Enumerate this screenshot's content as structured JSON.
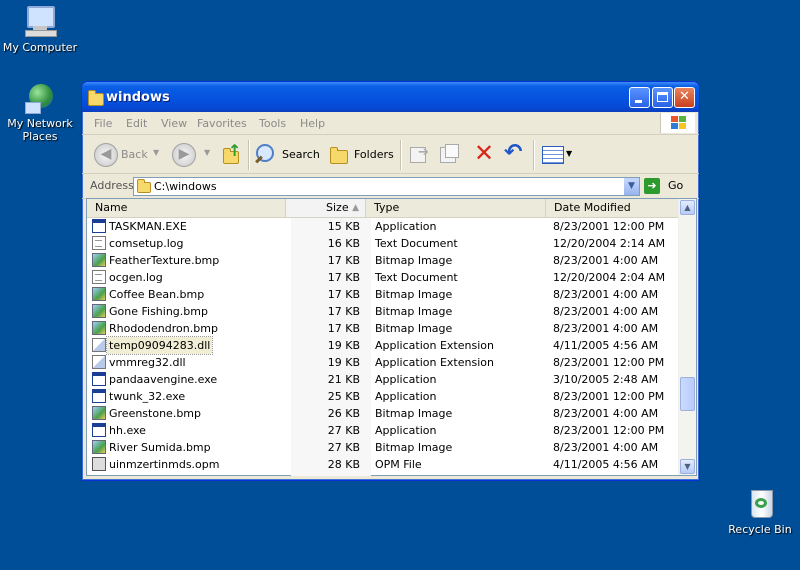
{
  "desktop": {
    "my_computer": "My Computer",
    "my_network": "My Network Places",
    "recycle_bin": "Recycle Bin"
  },
  "window": {
    "title": "windows",
    "menu": [
      "File",
      "Edit",
      "View",
      "Favorites",
      "Tools",
      "Help"
    ],
    "toolbar": {
      "back": "Back",
      "search": "Search",
      "folders": "Folders"
    },
    "address": {
      "label": "Address",
      "value": "C:\\windows",
      "go": "Go"
    },
    "columns": {
      "name": "Name",
      "size": "Size",
      "type": "Type",
      "date": "Date Modified"
    },
    "files": [
      {
        "name": "TASKMAN.EXE",
        "size": "15 KB",
        "type": "Application",
        "date": "8/23/2001 12:00 PM",
        "icon": "app"
      },
      {
        "name": "comsetup.log",
        "size": "16 KB",
        "type": "Text Document",
        "date": "12/20/2004 2:14 AM",
        "icon": "txt"
      },
      {
        "name": "FeatherTexture.bmp",
        "size": "17 KB",
        "type": "Bitmap Image",
        "date": "8/23/2001 4:00 AM",
        "icon": "bmp"
      },
      {
        "name": "ocgen.log",
        "size": "17 KB",
        "type": "Text Document",
        "date": "12/20/2004 2:04 AM",
        "icon": "txt"
      },
      {
        "name": "Coffee Bean.bmp",
        "size": "17 KB",
        "type": "Bitmap Image",
        "date": "8/23/2001 4:00 AM",
        "icon": "bmp"
      },
      {
        "name": "Gone Fishing.bmp",
        "size": "17 KB",
        "type": "Bitmap Image",
        "date": "8/23/2001 4:00 AM",
        "icon": "bmp"
      },
      {
        "name": "Rhododendron.bmp",
        "size": "17 KB",
        "type": "Bitmap Image",
        "date": "8/23/2001 4:00 AM",
        "icon": "bmp"
      },
      {
        "name": "temp09094283.dll",
        "size": "19 KB",
        "type": "Application Extension",
        "date": "4/11/2005 4:56 AM",
        "icon": "dll"
      },
      {
        "name": "vmmreg32.dll",
        "size": "19 KB",
        "type": "Application Extension",
        "date": "8/23/2001 12:00 PM",
        "icon": "dll"
      },
      {
        "name": "pandaavengine.exe",
        "size": "21 KB",
        "type": "Application",
        "date": "3/10/2005 2:48 AM",
        "icon": "app"
      },
      {
        "name": "twunk_32.exe",
        "size": "25 KB",
        "type": "Application",
        "date": "8/23/2001 12:00 PM",
        "icon": "app"
      },
      {
        "name": "Greenstone.bmp",
        "size": "26 KB",
        "type": "Bitmap Image",
        "date": "8/23/2001 4:00 AM",
        "icon": "bmp"
      },
      {
        "name": "hh.exe",
        "size": "27 KB",
        "type": "Application",
        "date": "8/23/2001 12:00 PM",
        "icon": "app"
      },
      {
        "name": "River Sumida.bmp",
        "size": "27 KB",
        "type": "Bitmap Image",
        "date": "8/23/2001 4:00 AM",
        "icon": "bmp"
      },
      {
        "name": "uinmzertinmds.opm",
        "size": "28 KB",
        "type": "OPM File",
        "date": "4/11/2005 4:56 AM",
        "icon": "opm"
      }
    ],
    "selected_index": 7
  }
}
